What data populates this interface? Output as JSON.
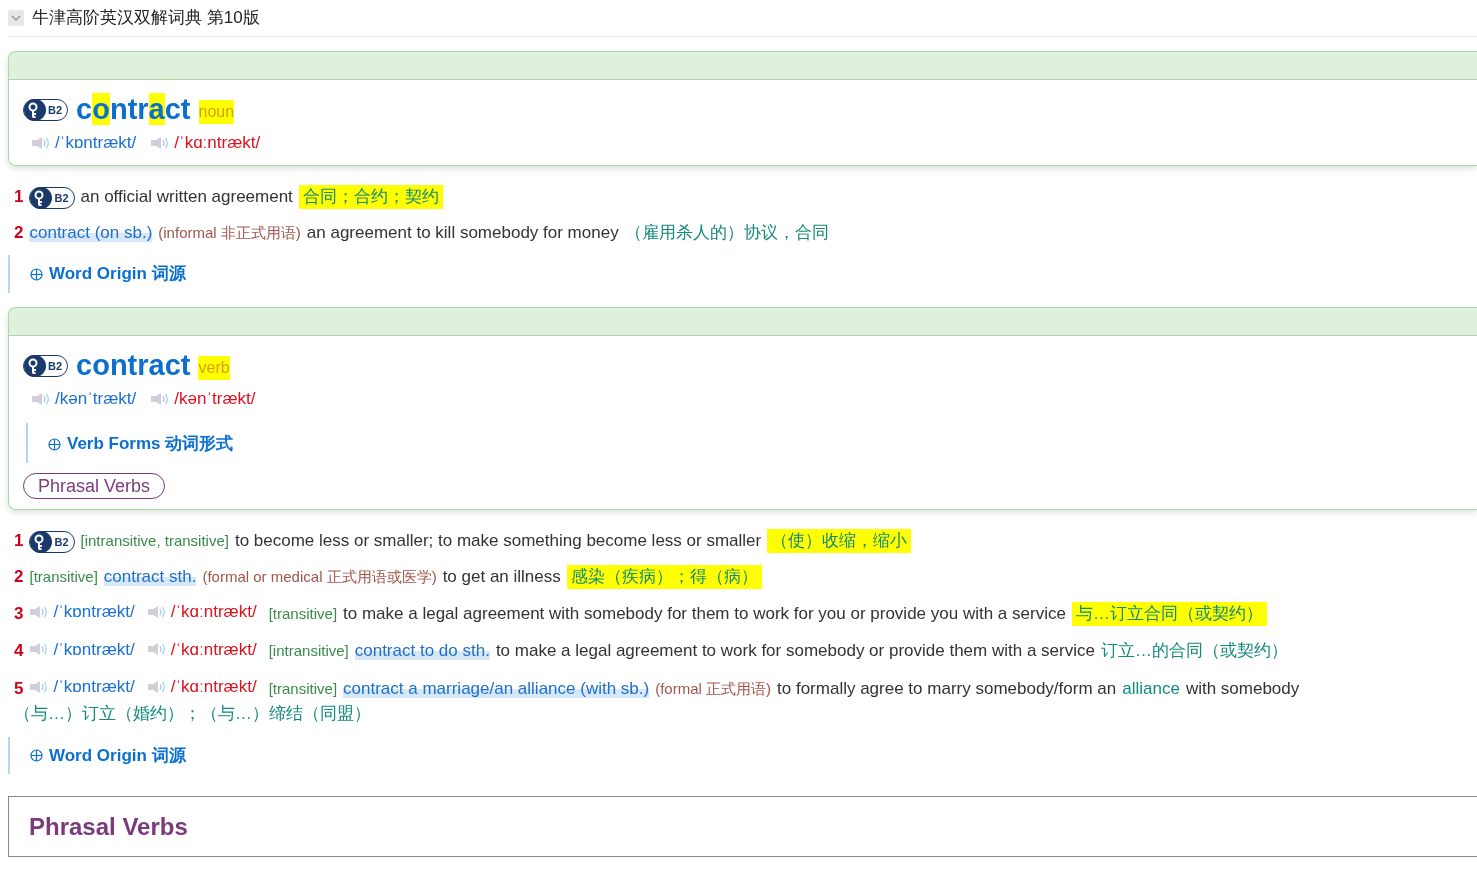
{
  "dictionary": {
    "title": "牛津高阶英汉双解词典 第10版",
    "expanded": true
  },
  "entries": [
    {
      "level": "B2",
      "headword_parts": [
        {
          "text": "c",
          "highlighted": false
        },
        {
          "text": "o",
          "highlighted": true
        },
        {
          "text": "ntr",
          "highlighted": false
        },
        {
          "text": "a",
          "highlighted": true
        },
        {
          "text": "ct",
          "highlighted": false
        }
      ],
      "pos": "noun",
      "pronunciations": [
        {
          "kind": "uk",
          "text": "/ˈkɒntrækt/"
        },
        {
          "kind": "us",
          "text": "/ˈkɑːntrækt/"
        }
      ],
      "senses": [
        {
          "number": "1",
          "level": "B2",
          "segments": [
            {
              "kind": "def",
              "text": "an official written agreement"
            },
            {
              "kind": "zh",
              "text": "合同；合约；契约",
              "highlighted": true
            }
          ]
        },
        {
          "number": "2",
          "segments": [
            {
              "kind": "pattern",
              "text": "contract (on sb.)"
            },
            {
              "kind": "register",
              "text": "(informal 非正式用语)"
            },
            {
              "kind": "def",
              "text": "an agreement to kill somebody for money"
            },
            {
              "kind": "zh",
              "text": "（雇用杀人的）协议，合同",
              "highlighted": false
            }
          ]
        }
      ],
      "word_origin": "Word Origin 词源"
    },
    {
      "level": "B2",
      "headword_parts": [
        {
          "text": "contract",
          "highlighted": false
        }
      ],
      "pos": "verb",
      "pronunciations": [
        {
          "kind": "uk",
          "text": "/kənˈtrækt/"
        },
        {
          "kind": "us",
          "text": "/kənˈtrækt/"
        }
      ],
      "verb_forms": "Verb Forms 动词形式",
      "phrasal_verbs_button": "Phrasal Verbs",
      "senses": [
        {
          "number": "1",
          "level": "B2",
          "segments": [
            {
              "kind": "grammar",
              "text": "[intransitive, transitive]"
            },
            {
              "kind": "def",
              "text": "to become less or smaller; to make something become less or smaller"
            },
            {
              "kind": "zh",
              "text": "（使）收缩，缩小",
              "highlighted": true
            }
          ]
        },
        {
          "number": "2",
          "segments": [
            {
              "kind": "grammar",
              "text": "[transitive]"
            },
            {
              "kind": "pattern",
              "text": "contract sth."
            },
            {
              "kind": "register",
              "text": "(formal or medical 正式用语或医学)"
            },
            {
              "kind": "def",
              "text": "to get an illness"
            },
            {
              "kind": "zh",
              "text": "感染（疾病）；得（病）",
              "highlighted": true
            }
          ]
        },
        {
          "number": "3",
          "pronunciations": [
            {
              "kind": "uk",
              "text": "/ˈkɒntrækt/"
            },
            {
              "kind": "us",
              "text": "/ˈkɑːntrækt/"
            }
          ],
          "segments": [
            {
              "kind": "grammar",
              "text": "[transitive]"
            },
            {
              "kind": "def",
              "text": "to make a legal agreement with somebody for them to work for you or provide you with a service"
            },
            {
              "kind": "zh",
              "text": "与…订立合同（或契约）",
              "highlighted": true
            }
          ]
        },
        {
          "number": "4",
          "pronunciations": [
            {
              "kind": "uk",
              "text": "/ˈkɒntrækt/"
            },
            {
              "kind": "us",
              "text": "/ˈkɑːntrækt/"
            }
          ],
          "segments": [
            {
              "kind": "grammar",
              "text": "[intransitive]"
            },
            {
              "kind": "pattern",
              "text": "contract to do sth."
            },
            {
              "kind": "def",
              "text": "to make a legal agreement to work for somebody or provide them with a service"
            },
            {
              "kind": "zh",
              "text": "订立…的合同（或契约）",
              "highlighted": false
            }
          ]
        },
        {
          "number": "5",
          "pronunciations": [
            {
              "kind": "uk",
              "text": "/ˈkɒntrækt/"
            },
            {
              "kind": "us",
              "text": "/ˈkɑːntrækt/"
            }
          ],
          "segments": [
            {
              "kind": "grammar",
              "text": "[transitive]"
            },
            {
              "kind": "pattern",
              "text": "contract a marriage/an alliance (with sb.)"
            },
            {
              "kind": "register",
              "text": "(formal 正式用语)"
            },
            {
              "kind": "def",
              "text": "to formally agree to marry somebody/form an"
            },
            {
              "kind": "xref",
              "text": "alliance"
            },
            {
              "kind": "def",
              "text": "with somebody"
            },
            {
              "kind": "zh",
              "text": "（与…）订立（婚约）；（与…）缔结（同盟）",
              "highlighted": false
            }
          ]
        }
      ],
      "word_origin": "Word Origin 词源"
    }
  ],
  "phrasal_verbs_section": {
    "title": "Phrasal Verbs"
  }
}
